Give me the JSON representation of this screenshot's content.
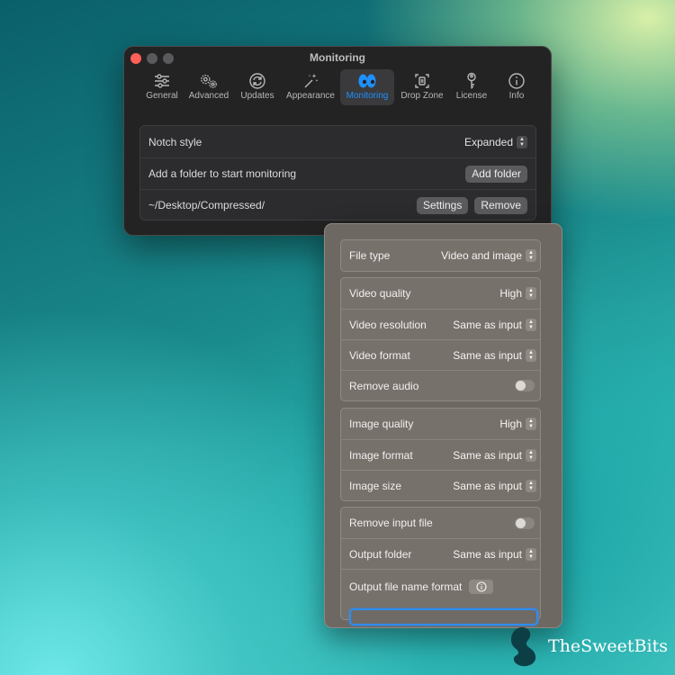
{
  "window": {
    "title": "Monitoring",
    "tabs": [
      {
        "label": "General",
        "icon": "sliders-icon"
      },
      {
        "label": "Advanced",
        "icon": "gears-icon"
      },
      {
        "label": "Updates",
        "icon": "refresh-icon"
      },
      {
        "label": "Appearance",
        "icon": "magic-wand-icon"
      },
      {
        "label": "Monitoring",
        "icon": "eyes-icon",
        "active": true
      },
      {
        "label": "Drop Zone",
        "icon": "drop-zone-icon"
      },
      {
        "label": "License",
        "icon": "key-icon"
      },
      {
        "label": "Info",
        "icon": "info-icon"
      }
    ]
  },
  "monitoring": {
    "notch_style_label": "Notch style",
    "notch_style_value": "Expanded",
    "add_folder_label": "Add a folder to start monitoring",
    "add_folder_button": "Add folder",
    "folder_path": "~/Desktop/Compressed/",
    "settings_button": "Settings",
    "remove_button": "Remove"
  },
  "popover": {
    "file_type_label": "File type",
    "file_type_value": "Video and image",
    "video_quality_label": "Video quality",
    "video_quality_value": "High",
    "video_resolution_label": "Video resolution",
    "video_resolution_value": "Same as input",
    "video_format_label": "Video format",
    "video_format_value": "Same as input",
    "remove_audio_label": "Remove audio",
    "remove_audio_on": false,
    "image_quality_label": "Image quality",
    "image_quality_value": "High",
    "image_format_label": "Image format",
    "image_format_value": "Same as input",
    "image_size_label": "Image size",
    "image_size_value": "Same as input",
    "remove_input_label": "Remove input file",
    "remove_input_on": false,
    "output_folder_label": "Output folder",
    "output_folder_value": "Same as input",
    "output_name_label": "Output file name format",
    "output_name_value": ""
  },
  "watermark": {
    "brand": "TheSweetBits"
  },
  "colors": {
    "accent": "#1e90ff",
    "close": "#fe5f57",
    "window_bg": "#232324",
    "popover_bg": "#6e6863"
  }
}
